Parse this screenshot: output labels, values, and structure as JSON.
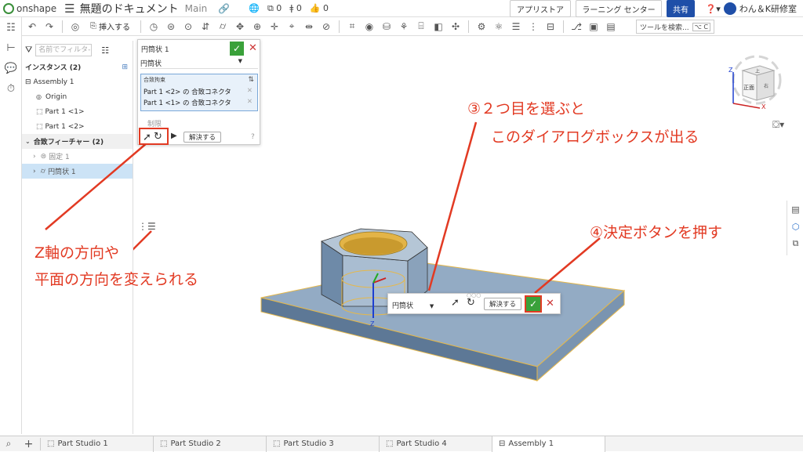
{
  "header": {
    "logo": "onshape",
    "doc_title": "無題のドキュメント",
    "branch": "Main",
    "count1": "0",
    "count2": "0",
    "count3": "0",
    "app_store": "アプリストア",
    "learning": "ラーニング センター",
    "share": "共有",
    "user": "わん＆K研修室"
  },
  "toolbar": {
    "insert": "挿入する",
    "tool_search": "ツールを検索...",
    "shortcut": "⌥ C"
  },
  "panel": {
    "filter_placeholder": "名前でフィルタ-",
    "instances_header": "インスタンス (2)",
    "assembly": "Assembly 1",
    "origin": "Origin",
    "part1": "Part 1 <1>",
    "part2": "Part 1 <2>",
    "mate_features": "合致フィーチャー (2)",
    "fixed": "固定 1",
    "cylindrical": "円筒状 1"
  },
  "dialog1": {
    "title": "円筒状 1",
    "type": "円筒状",
    "mate_label": "合致拘束",
    "item1": "Part 1 <2> の 合致コネクタ",
    "item2": "Part 1 <1> の 合致コネクタ",
    "limits": "制限",
    "resolve": "解決する"
  },
  "dialog2": {
    "type": "円筒状",
    "resolve": "解決する"
  },
  "annotations": {
    "step3_line1": "③２つ目を選ぶと",
    "step3_line2": "このダイアログボックスが出る",
    "step4": "④決定ボタンを押す",
    "flip_line1": "Z軸の方向や",
    "flip_line2": "平面の方向を変えられる"
  },
  "cube": {
    "top": "上",
    "front": "正面",
    "right": "右",
    "axis_z": "Z",
    "axis_x": "X"
  },
  "triad": {
    "z": "Z"
  },
  "tabs": [
    "Part Studio 1",
    "Part Studio 2",
    "Part Studio 3",
    "Part Studio 4",
    "Assembly 1"
  ],
  "colors": {
    "accent": "#1f4fa8",
    "ok_green": "#3aa13a",
    "annotation_red": "#e23a23",
    "part_blue": "#93abc4",
    "part_gold": "#e6b84a"
  }
}
